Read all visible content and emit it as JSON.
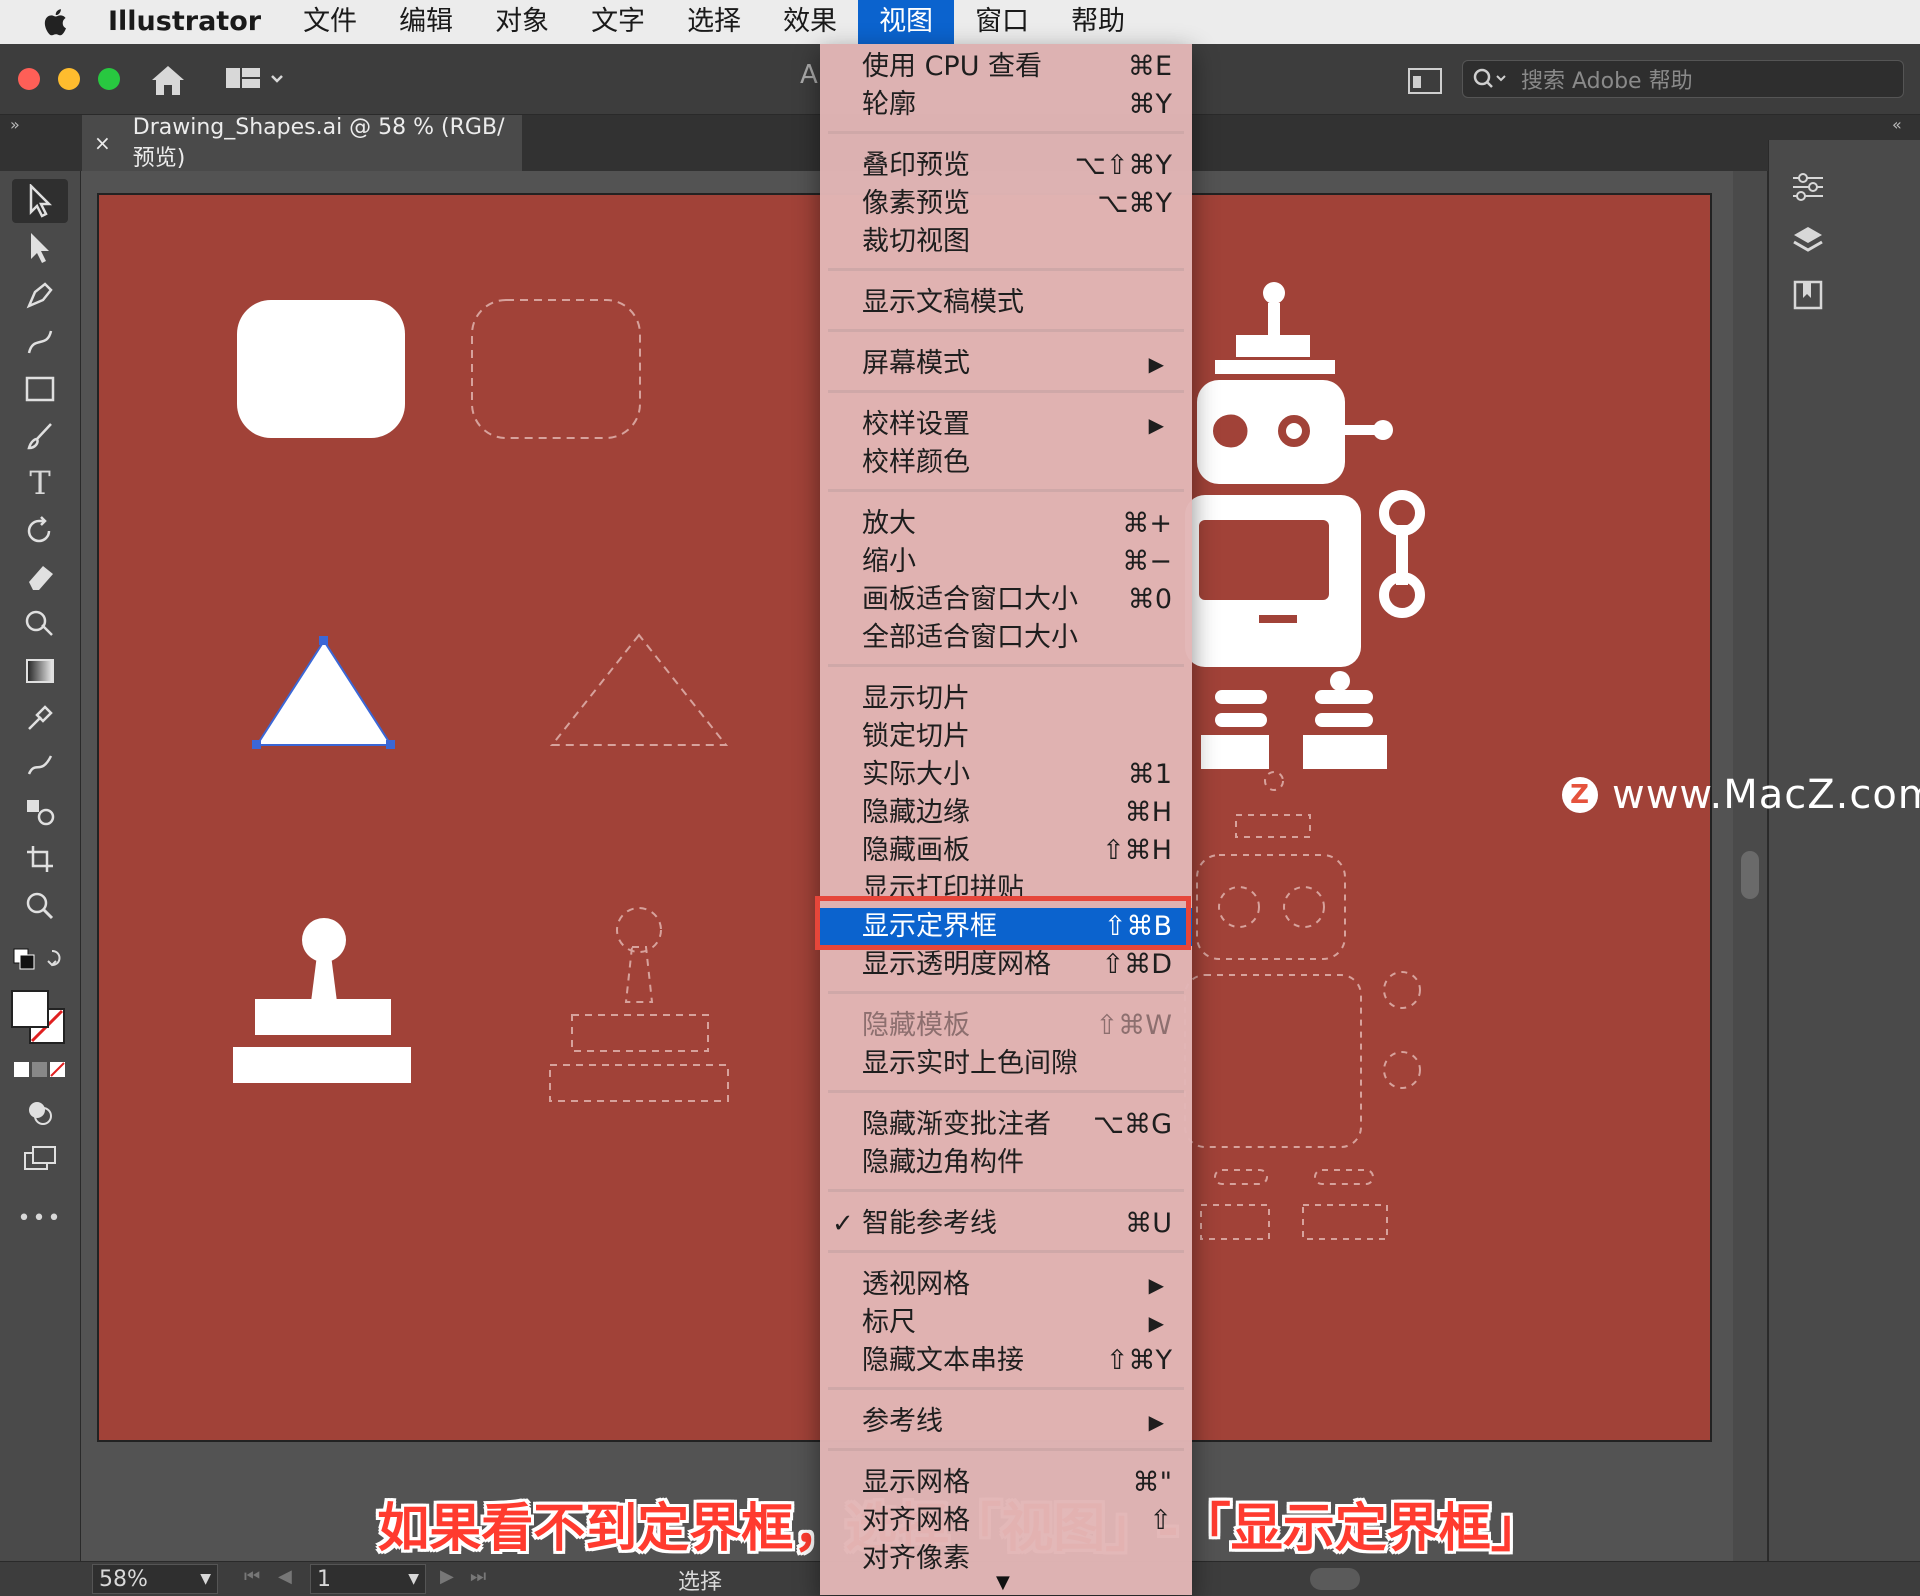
{
  "menubar": {
    "app": "Illustrator",
    "items": [
      "文件",
      "编辑",
      "对象",
      "文字",
      "选择",
      "效果",
      "视图",
      "窗口",
      "帮助"
    ],
    "active_index": 6
  },
  "appbar": {
    "search_placeholder": "搜索 Adobe 帮助",
    "partial_letter": "A"
  },
  "document": {
    "tab_title": "Drawing_Shapes.ai @ 58 % (RGB/预览)",
    "close": "×"
  },
  "toolbar": {
    "more": "•••",
    "tools": [
      "selection-tool-icon",
      "direct-selection-tool-icon",
      "pen-tool-icon",
      "curvature-tool-icon",
      "rectangle-tool-icon",
      "paintbrush-tool-icon",
      "type-tool-icon",
      "rotate-tool-icon",
      "eraser-tool-icon",
      "shape-builder-tool-icon",
      "gradient-tool-icon",
      "eyedropper-tool-icon",
      "puppet-warp-tool-icon",
      "blend-tool-icon",
      "artboard-tool-icon",
      "zoom-tool-icon"
    ]
  },
  "view_menu": {
    "items": [
      {
        "label": "使用 CPU 查看",
        "shortcut": "⌘E"
      },
      {
        "label": "轮廓",
        "shortcut": "⌘Y"
      },
      {
        "sep": true
      },
      {
        "label": "叠印预览",
        "shortcut": "⌥⇧⌘Y"
      },
      {
        "label": "像素预览",
        "shortcut": "⌥⌘Y"
      },
      {
        "label": "裁切视图",
        "shortcut": ""
      },
      {
        "sep": true
      },
      {
        "label": "显示文稿模式",
        "shortcut": ""
      },
      {
        "sep": true
      },
      {
        "label": "屏幕模式",
        "submenu": true
      },
      {
        "sep": true
      },
      {
        "label": "校样设置",
        "submenu": true
      },
      {
        "label": "校样颜色",
        "shortcut": ""
      },
      {
        "sep": true
      },
      {
        "label": "放大",
        "shortcut": "⌘+"
      },
      {
        "label": "缩小",
        "shortcut": "⌘−"
      },
      {
        "label": "画板适合窗口大小",
        "shortcut": "⌘0"
      },
      {
        "label": "全部适合窗口大小",
        "shortcut": ""
      },
      {
        "sep": true
      },
      {
        "label": "显示切片",
        "shortcut": ""
      },
      {
        "label": "锁定切片",
        "shortcut": ""
      },
      {
        "label": "实际大小",
        "shortcut": "⌘1"
      },
      {
        "label": "隐藏边缘",
        "shortcut": "⌘H"
      },
      {
        "label": "隐藏画板",
        "shortcut": "⇧⌘H"
      },
      {
        "label": "显示打印拼贴",
        "shortcut": ""
      },
      {
        "label": "显示定界框",
        "shortcut": "⇧⌘B",
        "highlighted": true
      },
      {
        "label": "显示透明度网格",
        "shortcut": "⇧⌘D"
      },
      {
        "sep": true
      },
      {
        "label": "隐藏模板",
        "shortcut": "⇧⌘W",
        "disabled": true
      },
      {
        "label": "显示实时上色间隙",
        "shortcut": ""
      },
      {
        "sep": true
      },
      {
        "label": "隐藏渐变批注者",
        "shortcut": "⌥⌘G"
      },
      {
        "label": "隐藏边角构件",
        "shortcut": ""
      },
      {
        "sep": true
      },
      {
        "label": "智能参考线",
        "shortcut": "⌘U",
        "checked": true
      },
      {
        "sep": true
      },
      {
        "label": "透视网格",
        "submenu": true
      },
      {
        "label": "标尺",
        "submenu": true
      },
      {
        "label": "隐藏文本串接",
        "shortcut": "⇧⌘Y"
      },
      {
        "sep": true
      },
      {
        "label": "参考线",
        "submenu": true
      },
      {
        "sep": true
      },
      {
        "label": "显示网格",
        "shortcut": "⌘\""
      },
      {
        "label": "对齐网格",
        "shortcut": "⇧"
      },
      {
        "label": "对齐像素",
        "shortcut": ""
      }
    ],
    "check_mark": "✓",
    "submenu_arrow": "▶",
    "scroll_arrow": "▼"
  },
  "watermark": {
    "logo": "Z",
    "text": "www.MacZ.com"
  },
  "caption": "如果看不到定界框，选择「视图」-「显示定界框」",
  "statusbar": {
    "zoom": "58%",
    "artboard_number": "1",
    "tool_name": "选择"
  },
  "colors": {
    "artboard": "#a14238",
    "menu_bg": "#e2b6b6",
    "highlight": "#0b63ce",
    "frame": "#e6463a"
  }
}
